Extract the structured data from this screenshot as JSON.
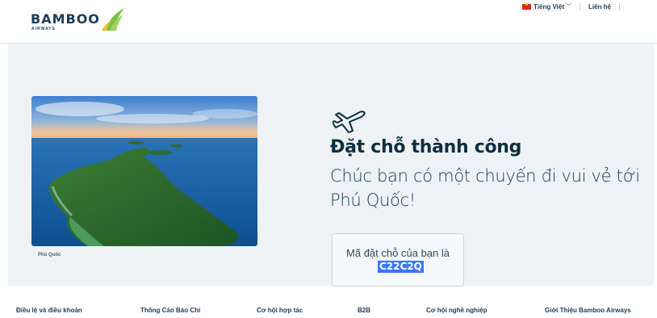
{
  "header": {
    "logo_text": "BAMBOO",
    "logo_sub": "AIRWAYS",
    "language_label": "Tiếng Việt",
    "contact_label": "Liên hệ"
  },
  "main": {
    "photo_caption": "Phú Quốc",
    "title": "Đặt chỗ thành công",
    "subtitle": "Chúc bạn có một chuyến đi vui vẻ tới Phú Quốc!",
    "booking_label": "Mã đặt chỗ của bạn là",
    "booking_code": "C22C2Q"
  },
  "footer": {
    "links": [
      "Điều lệ và điều khoản",
      "Thông Cáo Báo Chí",
      "Cơ hội hợp tác",
      "B2B",
      "Cơ hội nghề nghiệp",
      "Giới Thiệu Bamboo Airways"
    ]
  },
  "colors": {
    "brand_navy": "#1d3c58",
    "panel_bg": "#eef2f4",
    "highlight": "#3b76ff",
    "leaf_green": "#7cc242"
  }
}
